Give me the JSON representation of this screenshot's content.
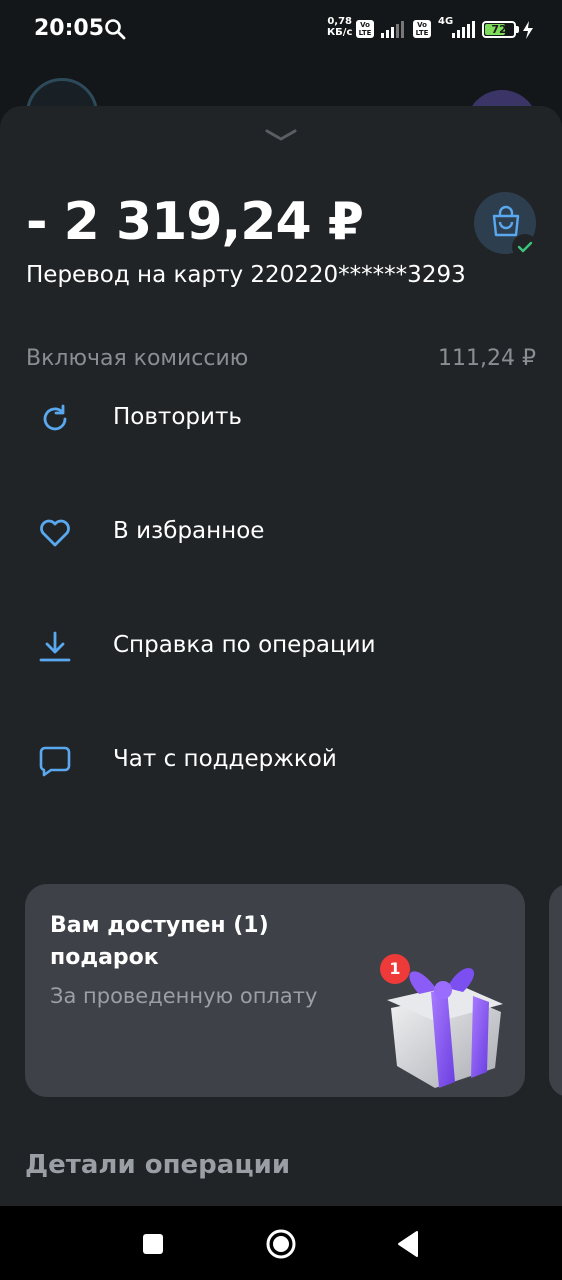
{
  "status_bar": {
    "time": "20:05",
    "net_speed_value": "0,78",
    "net_speed_unit": "КБ/с",
    "volte_label_top": "Vo",
    "volte_label_bottom": "LTE",
    "network_type": "4G",
    "battery_level": "72",
    "battery_fraction": 0.72
  },
  "transaction": {
    "amount": "- 2 319,24 ₽",
    "description": "Перевод на карту 220220******3293",
    "fee_label": "Включая комиссию",
    "fee_value": "111,24 ₽"
  },
  "actions": [
    {
      "label": "Повторить",
      "icon": "refresh-icon"
    },
    {
      "label": "В избранное",
      "icon": "heart-icon"
    },
    {
      "label": "Справка по операции",
      "icon": "download-icon"
    },
    {
      "label": "Чат с поддержкой",
      "icon": "chat-icon"
    }
  ],
  "promo": {
    "title": "Вам доступен (1) подарок",
    "subtitle": "За проведенную оплату",
    "badge_count": "1"
  },
  "details": {
    "section_title": "Детали операции"
  },
  "colors": {
    "background": "#141719",
    "sheet": "#212427",
    "accent_blue": "#5aa8f0",
    "card": "#3e4148",
    "success_green": "#3cc47a",
    "gift_purple": "#8b5cf6",
    "badge_red": "#ef3a3a"
  }
}
